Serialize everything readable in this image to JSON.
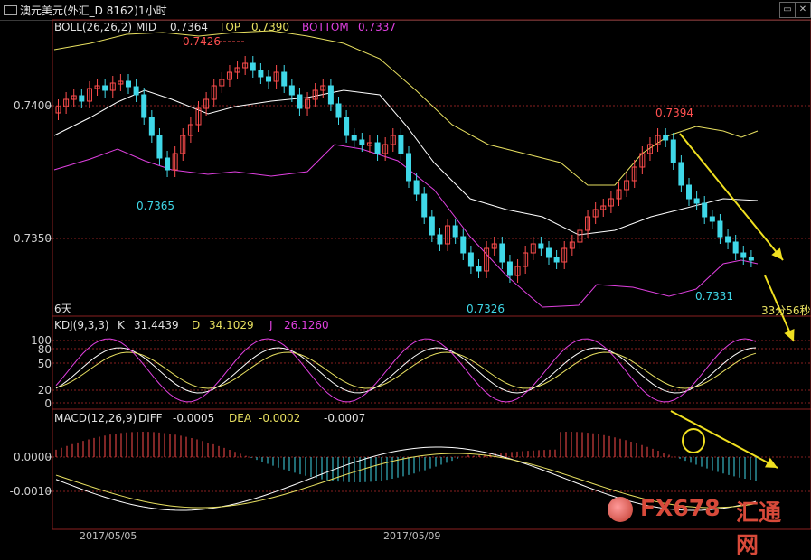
{
  "window": {
    "title": "澳元美元(外汇_D 8162)1小时"
  },
  "boll_panel": {
    "indicator": "BOLL(26,26,2)",
    "mid_label": "MID",
    "mid_value": "0.7364",
    "top_label": "TOP",
    "top_value": "0.7390",
    "bottom_label": "BOTTOM",
    "bottom_value": "0.7337",
    "y_ticks": [
      "0.7400",
      "0.7350"
    ],
    "annotations": {
      "high_left": "0.7426",
      "low_left": "0.7365",
      "low_mid": "0.7326",
      "high_right": "0.7394",
      "low_right": "0.7331"
    },
    "period_label": "6天",
    "countdown": "33分56秒"
  },
  "kdj_panel": {
    "indicator": "KDJ(9,3,3)",
    "k_label": "K",
    "k_value": "31.4439",
    "d_label": "D",
    "d_value": "34.1029",
    "j_label": "J",
    "j_value": "26.1260",
    "y_ticks": [
      "100",
      "80",
      "50",
      "20",
      "0"
    ]
  },
  "macd_panel": {
    "indicator": "MACD(12,26,9)",
    "diff_label": "DIFF",
    "diff_value": "-0.0005",
    "dea_label": "DEA",
    "dea_value": "-0.0002",
    "macd_value": "-0.0007",
    "y_ticks": [
      "0.0000",
      "-0.0010"
    ]
  },
  "x_axis": {
    "dates": [
      "2017/05/05",
      "2017/05/09"
    ]
  },
  "watermark": {
    "brand": "FX678",
    "brand_cn": "汇通网"
  },
  "colors": {
    "up_candle": "#ff4d4d",
    "down_candle": "#3fd8e8",
    "boll_top": "#e8e060",
    "boll_mid": "#ffffff",
    "boll_bottom": "#e040e0",
    "arrow": "#f0e020",
    "grid": "#8a2020"
  }
}
